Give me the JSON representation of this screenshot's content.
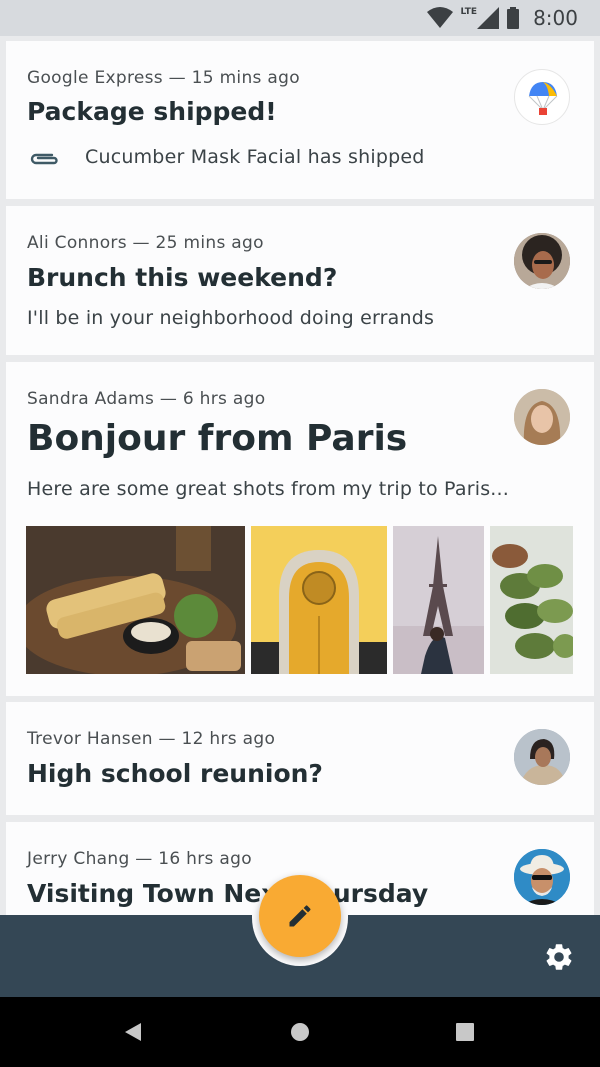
{
  "status_bar": {
    "time": "8:00",
    "network": "LTE",
    "icons": [
      "wifi-icon",
      "signal-icon",
      "battery-icon"
    ]
  },
  "emails": [
    {
      "sender_line": "Google Express — 15 mins ago",
      "subject": "Package shipped!",
      "preview": "Cucumber Mask Facial has shipped",
      "attachment_icon": "paperclip-icon",
      "avatar": "google-express-avatar"
    },
    {
      "sender_line": "Ali Connors — 25 mins ago",
      "subject": "Brunch this weekend?",
      "preview": "I'll be in your neighborhood doing errands",
      "avatar": "ali-connors-avatar"
    },
    {
      "sender_line": "Sandra Adams — 6 hrs ago",
      "subject": "Bonjour from Paris",
      "preview": "Here are some great shots from my trip to Paris...",
      "avatar": "sandra-adams-avatar",
      "photos": [
        "food-photo",
        "yellow-door-photo",
        "eiffel-tower-photo",
        "macarons-photo"
      ]
    },
    {
      "sender_line": "Trevor Hansen — 12 hrs ago",
      "subject": "High school reunion?",
      "avatar": "trevor-hansen-avatar"
    },
    {
      "sender_line": "Jerry Chang — 16 hrs ago",
      "subject": "Visiting Town Next Thursday",
      "avatar": "jerry-chang-avatar"
    }
  ],
  "bottom_bar": {
    "fab_icon": "pencil-icon",
    "settings_icon": "gear-icon"
  },
  "nav_bar": {
    "icons": [
      "back-icon",
      "home-icon",
      "recents-icon"
    ]
  },
  "colors": {
    "accent": "#f9aa33",
    "bottom_bar": "#344755",
    "text": "#232f34"
  }
}
